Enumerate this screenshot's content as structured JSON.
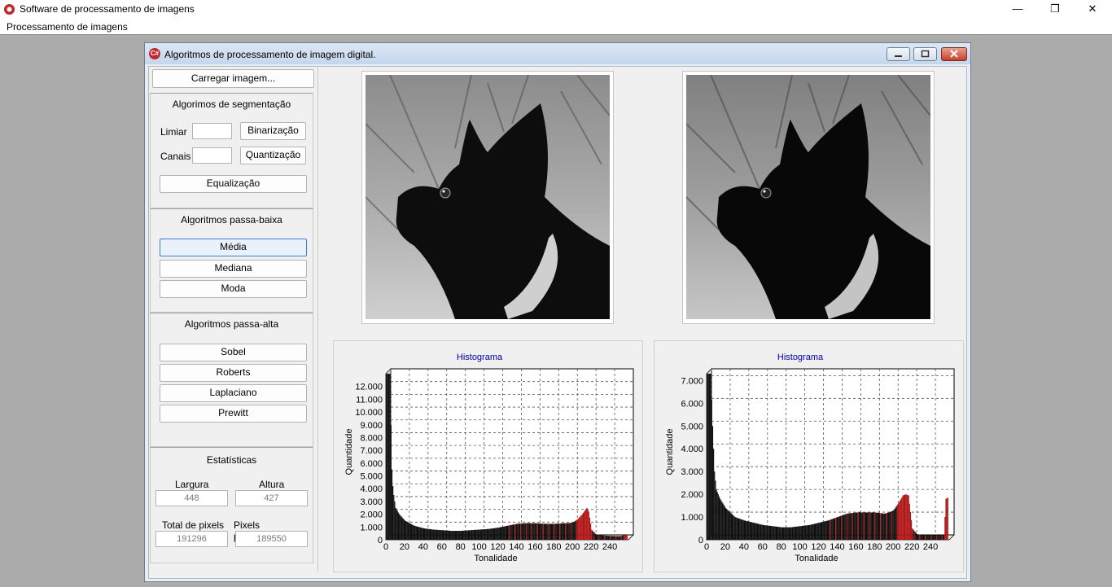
{
  "app": {
    "title": "Software de processamento de imagens",
    "menu": [
      "Processamento de imagens"
    ],
    "controls": {
      "minimize": "—",
      "restore": "❐",
      "close": "✕"
    }
  },
  "child": {
    "title": "Algoritmos de processamento de imagem digital.",
    "icon_text": "C#"
  },
  "load_button": "Carregar imagem...",
  "segmentation": {
    "title": "Algorimos de segmentação",
    "threshold_label": "Limiar",
    "threshold_value": "",
    "binarize_button": "Binarização",
    "channels_label": "Canais",
    "channels_value": "",
    "quantize_button": "Quantização",
    "equalize_button": "Equalização"
  },
  "lowpass": {
    "title": "Algoritmos passa-baixa",
    "buttons": [
      "Média",
      "Mediana",
      "Moda"
    ]
  },
  "highpass": {
    "title": "Algoritmos passa-alta",
    "buttons": [
      "Sobel",
      "Roberts",
      "Laplaciano",
      "Prewitt"
    ]
  },
  "stats": {
    "title": "Estatísticas",
    "width_label": "Largura",
    "width_value": "448",
    "height_label": "Altura",
    "height_value": "427",
    "total_label": "Total de pixels",
    "total_value": "191296",
    "processed_label": "Pixels processados",
    "processed_value": "189550"
  },
  "colors": {
    "bar_dark": "#111111",
    "bar_red": "#b01818",
    "chart_title": "#0000a8"
  },
  "chart_data": [
    {
      "type": "bar",
      "title": "Histograma",
      "xlabel": "Tonalidade",
      "ylabel": "Quantidade",
      "xlim": [
        0,
        260
      ],
      "ylim": [
        0,
        13000
      ],
      "xticks": [
        0,
        20,
        40,
        60,
        80,
        100,
        120,
        140,
        160,
        180,
        200,
        220,
        240
      ],
      "yticks": [
        0,
        1000,
        2000,
        3000,
        4000,
        5000,
        6000,
        7000,
        8000,
        9000,
        10000,
        11000,
        12000
      ],
      "ytick_labels": [
        "0",
        "1.000",
        "2.000",
        "3.000",
        "4.000",
        "5.000",
        "6.000",
        "7.000",
        "8.000",
        "9.000",
        "10.000",
        "11.000",
        "12.000"
      ],
      "grid": true,
      "points": [
        [
          0,
          13000
        ],
        [
          1,
          13000
        ],
        [
          2,
          13000
        ],
        [
          3,
          13000
        ],
        [
          4,
          13000
        ],
        [
          5,
          9000
        ],
        [
          6,
          5500
        ],
        [
          7,
          4200
        ],
        [
          8,
          3500
        ],
        [
          10,
          2500
        ],
        [
          14,
          2000
        ],
        [
          20,
          1500
        ],
        [
          30,
          1100
        ],
        [
          40,
          900
        ],
        [
          50,
          800
        ],
        [
          60,
          750
        ],
        [
          70,
          700
        ],
        [
          80,
          700
        ],
        [
          90,
          750
        ],
        [
          100,
          800
        ],
        [
          110,
          850
        ],
        [
          120,
          950
        ],
        [
          130,
          1100
        ],
        [
          140,
          1250
        ],
        [
          150,
          1300
        ],
        [
          160,
          1300
        ],
        [
          170,
          1250
        ],
        [
          180,
          1250
        ],
        [
          190,
          1300
        ],
        [
          195,
          1300
        ],
        [
          200,
          1350
        ],
        [
          205,
          1600
        ],
        [
          210,
          2000
        ],
        [
          213,
          2300
        ],
        [
          215,
          2500
        ],
        [
          217,
          2200
        ],
        [
          220,
          800
        ],
        [
          225,
          400
        ],
        [
          230,
          350
        ],
        [
          240,
          300
        ],
        [
          250,
          280
        ],
        [
          258,
          400
        ]
      ]
    },
    {
      "type": "bar",
      "title": "Histograma",
      "xlabel": "Tonalidade",
      "ylabel": "Quantidade",
      "xlim": [
        0,
        260
      ],
      "ylim": [
        0,
        7300
      ],
      "xticks": [
        0,
        20,
        40,
        60,
        80,
        100,
        120,
        140,
        160,
        180,
        200,
        220,
        240
      ],
      "yticks": [
        0,
        1000,
        2000,
        3000,
        4000,
        5000,
        6000,
        7000
      ],
      "ytick_labels": [
        "0",
        "1.000",
        "2.000",
        "3.000",
        "4.000",
        "5.000",
        "6.000",
        "7.000"
      ],
      "grid": true,
      "points": [
        [
          0,
          7300
        ],
        [
          1,
          7300
        ],
        [
          2,
          7300
        ],
        [
          3,
          7300
        ],
        [
          4,
          7300
        ],
        [
          6,
          5000
        ],
        [
          8,
          3000
        ],
        [
          10,
          2200
        ],
        [
          14,
          1800
        ],
        [
          20,
          1400
        ],
        [
          30,
          1000
        ],
        [
          40,
          850
        ],
        [
          50,
          750
        ],
        [
          60,
          650
        ],
        [
          70,
          600
        ],
        [
          80,
          550
        ],
        [
          90,
          550
        ],
        [
          100,
          600
        ],
        [
          110,
          650
        ],
        [
          120,
          750
        ],
        [
          130,
          850
        ],
        [
          140,
          1000
        ],
        [
          150,
          1150
        ],
        [
          160,
          1200
        ],
        [
          170,
          1200
        ],
        [
          180,
          1200
        ],
        [
          190,
          1150
        ],
        [
          195,
          1200
        ],
        [
          200,
          1300
        ],
        [
          205,
          1600
        ],
        [
          210,
          1950
        ],
        [
          213,
          2000
        ],
        [
          216,
          1950
        ],
        [
          220,
          500
        ],
        [
          225,
          250
        ],
        [
          230,
          200
        ],
        [
          240,
          200
        ],
        [
          250,
          200
        ],
        [
          254,
          200
        ],
        [
          256,
          1800
        ],
        [
          258,
          1850
        ]
      ]
    }
  ]
}
